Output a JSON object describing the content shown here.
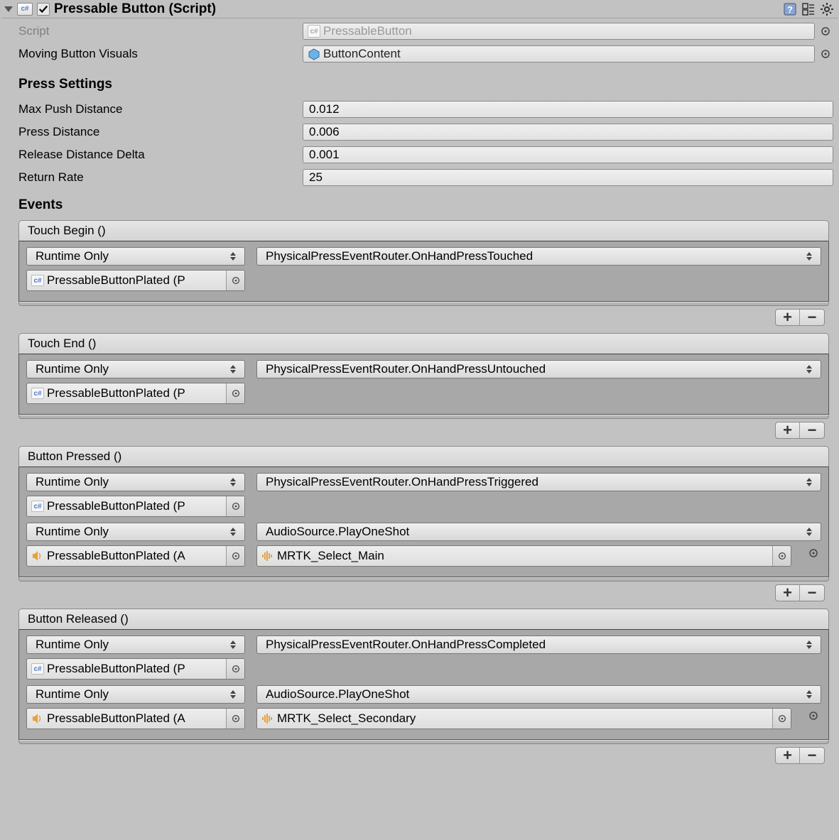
{
  "header": {
    "title": "Pressable Button (Script)",
    "enabled": true
  },
  "script": {
    "label": "Script",
    "value": "PressableButton"
  },
  "movingVisuals": {
    "label": "Moving Button Visuals",
    "value": "ButtonContent"
  },
  "pressSettings": {
    "title": "Press Settings",
    "maxPush": {
      "label": "Max Push Distance",
      "value": "0.012"
    },
    "pressDist": {
      "label": "Press Distance",
      "value": "0.006"
    },
    "releaseDelta": {
      "label": "Release Distance Delta",
      "value": "0.001"
    },
    "returnRate": {
      "label": "Return Rate",
      "value": "25"
    }
  },
  "events": {
    "title": "Events",
    "touchBegin": {
      "title": "Touch Begin ()",
      "listeners": [
        {
          "mode": "Runtime Only",
          "func": "PhysicalPressEventRouter.OnHandPressTouched",
          "target": "PressableButtonPlated (P",
          "targetIcon": "cs"
        }
      ]
    },
    "touchEnd": {
      "title": "Touch End ()",
      "listeners": [
        {
          "mode": "Runtime Only",
          "func": "PhysicalPressEventRouter.OnHandPressUntouched",
          "target": "PressableButtonPlated (P",
          "targetIcon": "cs"
        }
      ]
    },
    "buttonPressed": {
      "title": "Button Pressed ()",
      "listeners": [
        {
          "mode": "Runtime Only",
          "func": "PhysicalPressEventRouter.OnHandPressTriggered",
          "target": "PressableButtonPlated (P",
          "targetIcon": "cs"
        },
        {
          "mode": "Runtime Only",
          "func": "AudioSource.PlayOneShot",
          "target": "PressableButtonPlated (A",
          "targetIcon": "speaker",
          "arg": "MRTK_Select_Main",
          "argIcon": "audio"
        }
      ]
    },
    "buttonReleased": {
      "title": "Button Released ()",
      "listeners": [
        {
          "mode": "Runtime Only",
          "func": "PhysicalPressEventRouter.OnHandPressCompleted",
          "target": "PressableButtonPlated (P",
          "targetIcon": "cs"
        },
        {
          "mode": "Runtime Only",
          "func": "AudioSource.PlayOneShot",
          "target": "PressableButtonPlated (A",
          "targetIcon": "speaker",
          "arg": "MRTK_Select_Secondary",
          "argIcon": "audio"
        }
      ]
    }
  },
  "buttons": {
    "plus": "+",
    "minus": "−"
  }
}
